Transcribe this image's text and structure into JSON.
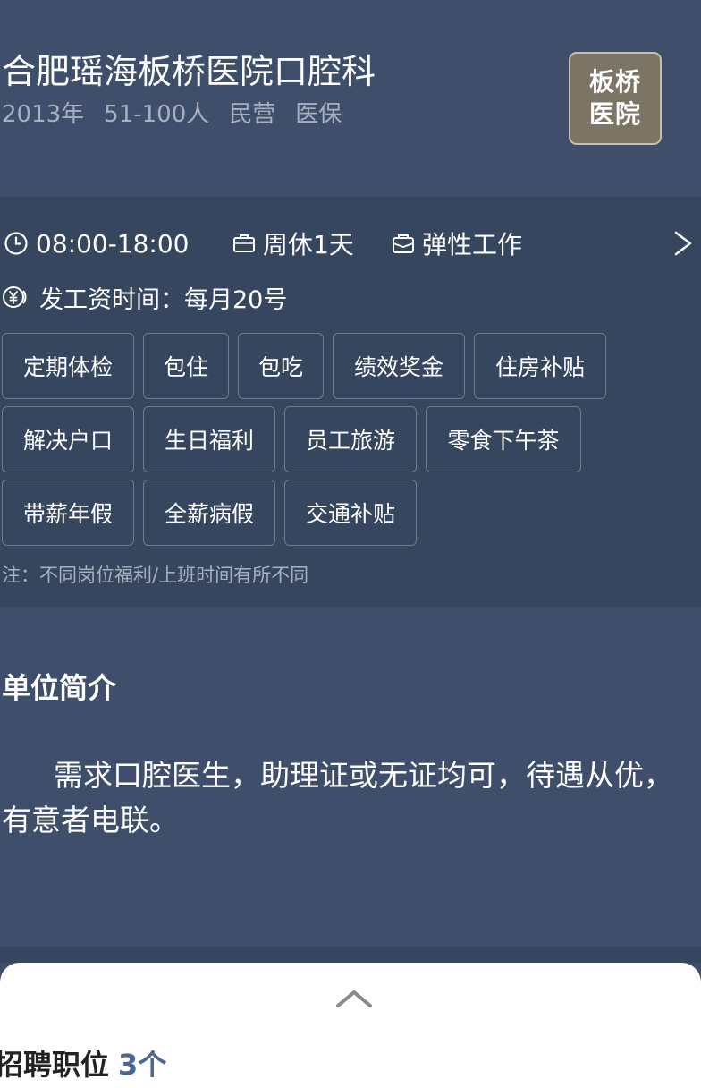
{
  "company": {
    "name": "合肥瑶海板桥医院口腔科",
    "meta": [
      "2013年",
      "51-100人",
      "民营",
      "医保"
    ],
    "logo_lines": [
      "板桥",
      "医院"
    ],
    "logo_color": "#7c7465"
  },
  "work_info": {
    "hours": "08:00-18:00",
    "rest": "周休1天",
    "mode": "弹性工作",
    "pay_day": "发工资时间：每月20号"
  },
  "benefits": [
    "定期体检",
    "包住",
    "包吃",
    "绩效奖金",
    "住房补贴",
    "解决户口",
    "生日福利",
    "员工旅游",
    "零食下午茶",
    "带薪年假",
    "全薪病假",
    "交通补贴"
  ],
  "note": "注：不同岗位福利/上班时间有所不同",
  "intro": {
    "title": "单位简介",
    "text": "需求口腔医生，助理证或无证均可，待遇从优，有意者电联。"
  },
  "positions": {
    "label": "招聘职位",
    "count": "3个"
  },
  "colors": {
    "background": "#3f4f6b",
    "panel": "#37465f",
    "accent": "#4a6896"
  }
}
